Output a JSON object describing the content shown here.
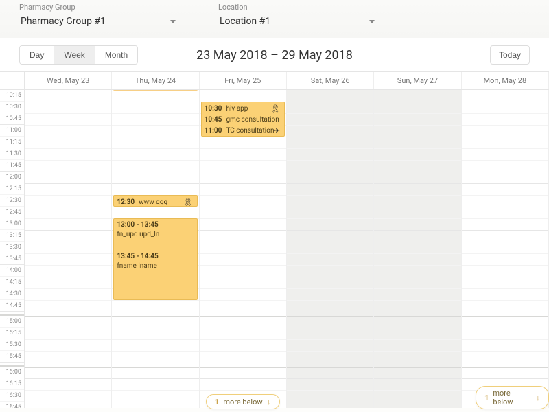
{
  "filters": {
    "group_label": "Pharmacy Group",
    "group_value": "Pharmacy Group #1",
    "location_label": "Location",
    "location_value": "Location #1"
  },
  "toolbar": {
    "day": "Day",
    "week": "Week",
    "month": "Month",
    "today": "Today",
    "date_range": "23 May 2018 – 29 May 2018"
  },
  "days": {
    "d0": "Wed, May 23",
    "d1": "Thu, May 24",
    "d2": "Fri, May 25",
    "d3": "Sat, May 26",
    "d4": "Sun, May 27",
    "d5": "Mon, May 28"
  },
  "times_a": [
    "10:15",
    "10:30",
    "10:45",
    "11:00",
    "11:15",
    "11:30",
    "11:45",
    "12:00",
    "12:15",
    "12:30",
    "12:45",
    "13:00",
    "13:15",
    "13:30",
    "13:45",
    "14:00",
    "14:15",
    "14:30",
    "14:45"
  ],
  "times_b": [
    "15:00",
    "15:15",
    "15:30",
    "15:45"
  ],
  "times_c": [
    "16:00",
    "16:15",
    "16:30",
    "16:45"
  ],
  "events": {
    "fri_1030_t": "10:30",
    "fri_1030_l": "hiv app",
    "fri_1045_t": "10:45",
    "fri_1045_l": "gmc consultation",
    "fri_1100_t": "11:00",
    "fri_1100_l": "TC consultation",
    "thu_1230_t": "12:30",
    "thu_1230_l": "www qqq",
    "thu_1300_t": "13:00 - 13:45",
    "thu_1300_l": "fn_upd upd_ln",
    "thu_1345_t": "13:45 - 14:45",
    "thu_1345_l": "fname lname"
  },
  "more": {
    "count1": "1",
    "label1": "more below",
    "count2": "1",
    "label2": "more below"
  },
  "icons": {
    "ribbon": "ribbon-icon",
    "plane": "airplane-icon"
  }
}
